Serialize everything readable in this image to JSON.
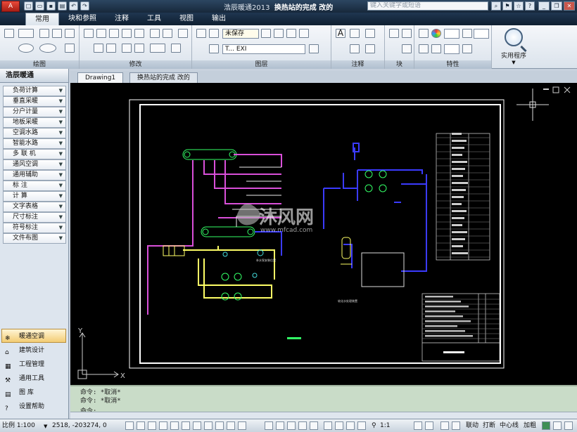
{
  "app": {
    "logo_text": "A",
    "title_prefix": "浩辰暖通2013",
    "document_title": "换热站的完成  改的",
    "search_placeholder": "键入关键字或短语"
  },
  "ribbon_tabs": [
    "常用",
    "块和参照",
    "注释",
    "工具",
    "视图",
    "输出"
  ],
  "ribbon": {
    "panels": [
      "绘图",
      "修改",
      "图层",
      "注释",
      "块",
      "特性"
    ],
    "layer_state": "未保存",
    "layer_name": "T... EXI",
    "utility_label": "实用程序"
  },
  "left_panel": {
    "title": "浩辰暖通",
    "menu": [
      "负荷计算",
      "垂直采暖",
      "分户计量",
      "地板采暖",
      "空调水路",
      "智能水路",
      "多 联 机",
      "通风空调",
      "通用辅助",
      "标    注",
      "计    算",
      "文字表格",
      "尺寸标注",
      "符号标注",
      "文件布图"
    ],
    "modules": [
      "暖通空调",
      "建筑设计",
      "工程管理",
      "通用工具",
      "图    库",
      "设置帮助"
    ]
  },
  "drawing_tabs": [
    "Drawing1",
    "换热站的完成  改的"
  ],
  "canvas": {
    "watermark_text": "沐风网",
    "watermark_url": "www.mfcad.com",
    "axis_x": "X",
    "axis_y": "Y",
    "annotation_1": "补水泵安装位置",
    "annotation_2": "软化水处理装置"
  },
  "command": {
    "lines": [
      "命令: *取消*",
      "命令: *取消*"
    ],
    "prompt": "命令:"
  },
  "status": {
    "scale": "比例 1:100",
    "coords": "2518,  -203274, 0",
    "anno_scale": "1:1",
    "buttons": [
      "联动",
      "打断",
      "中心线",
      "加粗"
    ]
  },
  "colors": {
    "canvas_bg": "#000000",
    "pipe_yellow": "#ffff66",
    "pipe_magenta": "#d94fd9",
    "pipe_blue": "#3b3bff",
    "pipe_green": "#33ff66",
    "border_white": "#ffffff"
  }
}
